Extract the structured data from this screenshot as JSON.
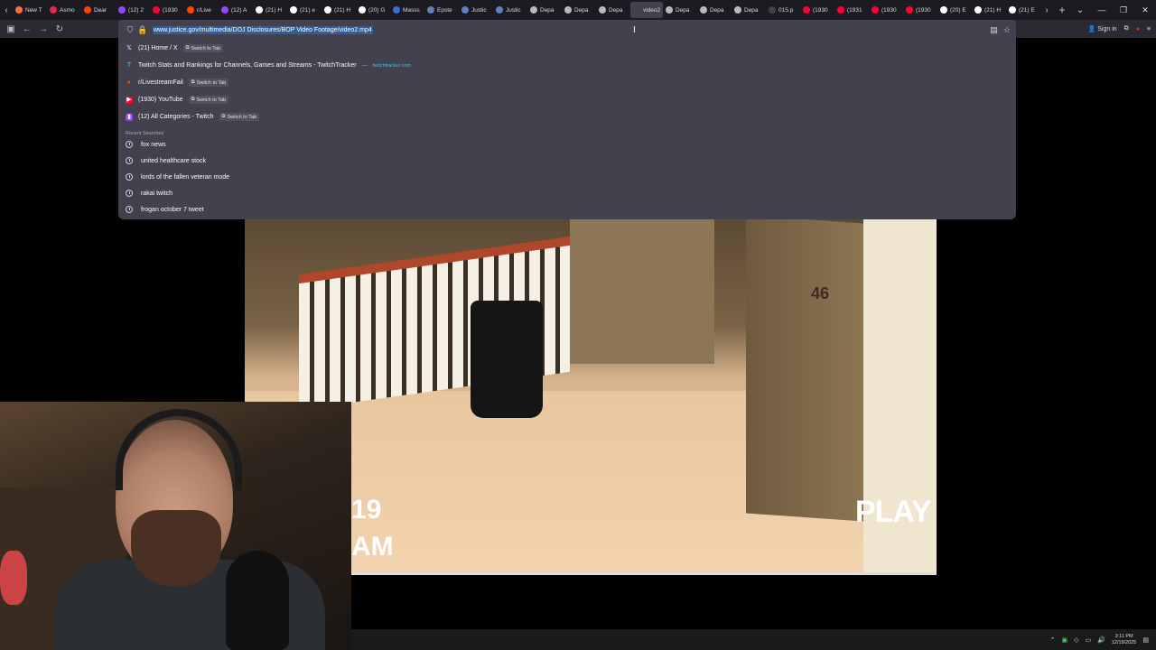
{
  "tabs": [
    {
      "title": "New T",
      "color": "#ff6a3d"
    },
    {
      "title": "Asmo",
      "color": "#e22850"
    },
    {
      "title": "Dear",
      "color": "#ff4500"
    },
    {
      "title": "(12) 2",
      "color": "#9146ff"
    },
    {
      "title": "(1930",
      "color": "#ff0033"
    },
    {
      "title": "r/Live",
      "color": "#ff4500"
    },
    {
      "title": "(12) A",
      "color": "#9146ff"
    },
    {
      "title": "(21) H",
      "color": "#ffffff"
    },
    {
      "title": "(21) e",
      "color": "#ffffff"
    },
    {
      "title": "(21) H",
      "color": "#ffffff"
    },
    {
      "title": "(20) G",
      "color": "#ffffff"
    },
    {
      "title": "Masss",
      "color": "#3b6bd6"
    },
    {
      "title": "Epste",
      "color": "#5f7fbf"
    },
    {
      "title": "Justic",
      "color": "#5f7fbf"
    },
    {
      "title": "Justic",
      "color": "#5f7fbf"
    },
    {
      "title": "Depa",
      "color": "#b9b9b9"
    },
    {
      "title": "Depa",
      "color": "#b9b9b9"
    },
    {
      "title": "Depa",
      "color": "#b9b9b9"
    },
    {
      "title": "video2",
      "color": "#42414d",
      "active": true
    },
    {
      "title": "Depa",
      "color": "#b9b9b9"
    },
    {
      "title": "Depa",
      "color": "#b9b9b9"
    },
    {
      "title": "Depa",
      "color": "#b9b9b9"
    },
    {
      "title": "015.p",
      "color": "#42414d"
    },
    {
      "title": "(1930",
      "color": "#ff0033"
    },
    {
      "title": "(1931",
      "color": "#ff0033"
    },
    {
      "title": "(1930",
      "color": "#ff0033"
    },
    {
      "title": "(1930",
      "color": "#ff0033"
    },
    {
      "title": "(20) E",
      "color": "#ffffff"
    },
    {
      "title": "(21) H",
      "color": "#ffffff"
    },
    {
      "title": "(21) E",
      "color": "#ffffff"
    }
  ],
  "urlbar": {
    "url": "www.justice.gov/multimedia/DOJ Disclosures/BOP Video Footage/video2.mp4"
  },
  "nav": {
    "sign_in": "Sign in"
  },
  "suggestions": [
    {
      "title": "(21) Home / X",
      "icon": "x-icon",
      "switch": "Switch to Tab"
    },
    {
      "title": "Twitch Stats and Rankings for Channels, Games and Streams - TwitchTracker",
      "icon": "twitchtracker-icon",
      "site": "twitchtracker.com"
    },
    {
      "title": "r/LivestreamFail",
      "icon": "reddit-icon",
      "switch": "Switch to Tab"
    },
    {
      "title": "(1930) YouTube",
      "icon": "youtube-icon",
      "switch": "Switch to Tab"
    },
    {
      "title": "(12) All Categories - Twitch",
      "icon": "twitch-icon",
      "switch": "Switch to Tab"
    }
  ],
  "recent_label": "Recent Searches",
  "recent": [
    "fox news",
    "united healthcare stock",
    "lords of the fallen veteran mode",
    "rakai twitch",
    "frogan october 7 tweet"
  ],
  "video": {
    "osd_play": "PLAY",
    "osd_time_a": "19",
    "osd_time_b": "AM",
    "door_number": "46"
  },
  "taskbar": {
    "time": "3:11 PM",
    "date": "12/19/2025"
  }
}
